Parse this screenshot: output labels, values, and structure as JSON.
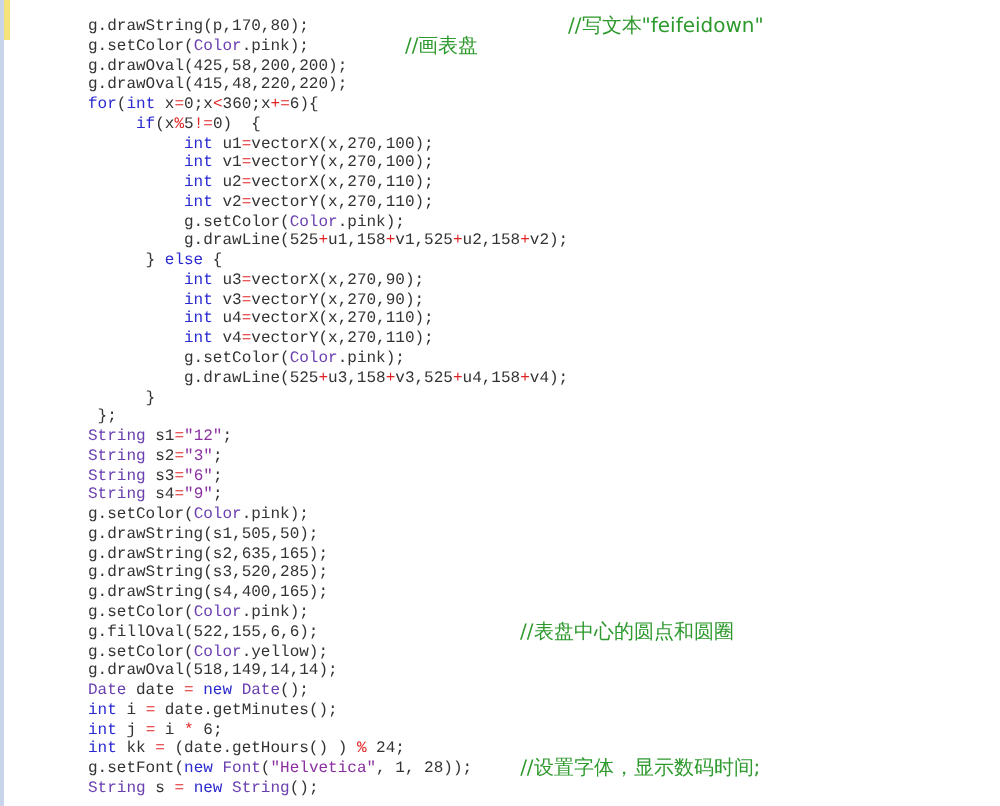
{
  "editor": {
    "lines": [
      {
        "code": [
          {
            "text": "g.drawString(p,170,80);                           ",
            "kind": "plain"
          }
        ],
        "comment": "//写文本\"feifeidown\""
      },
      {
        "code": [
          {
            "text": "g.setColor(",
            "kind": "plain"
          },
          {
            "text": "Color",
            "kind": "class"
          },
          {
            "text": ".pink);          ",
            "kind": "plain"
          }
        ],
        "comment": "//画表盘"
      },
      {
        "code": [
          {
            "text": "g.drawOval(425,58,200,200);",
            "kind": "plain"
          }
        ]
      },
      {
        "code": [
          {
            "text": "g.drawOval(415,48,220,220);",
            "kind": "plain"
          }
        ]
      },
      {
        "code": [
          {
            "text": "for",
            "kind": "keyword"
          },
          {
            "text": "(",
            "kind": "plain"
          },
          {
            "text": "int",
            "kind": "keyword"
          },
          {
            "text": " x",
            "kind": "plain"
          },
          {
            "text": "=",
            "kind": "operator"
          },
          {
            "text": "0;x",
            "kind": "plain"
          },
          {
            "text": "<",
            "kind": "operator"
          },
          {
            "text": "360;x",
            "kind": "plain"
          },
          {
            "text": "+=",
            "kind": "operator"
          },
          {
            "text": "6){",
            "kind": "plain"
          }
        ]
      },
      {
        "code": [
          {
            "text": "     if",
            "kind": "keyword"
          },
          {
            "text": "(x",
            "kind": "plain"
          },
          {
            "text": "%",
            "kind": "operator"
          },
          {
            "text": "5",
            "kind": "plain"
          },
          {
            "text": "!=",
            "kind": "operator"
          },
          {
            "text": "0)  {",
            "kind": "plain"
          }
        ]
      },
      {
        "code": [
          {
            "text": "          int",
            "kind": "keyword"
          },
          {
            "text": " u1",
            "kind": "plain"
          },
          {
            "text": "=",
            "kind": "operator"
          },
          {
            "text": "vectorX(x,270,100);",
            "kind": "plain"
          }
        ]
      },
      {
        "code": [
          {
            "text": "          int",
            "kind": "keyword"
          },
          {
            "text": " v1",
            "kind": "plain"
          },
          {
            "text": "=",
            "kind": "operator"
          },
          {
            "text": "vectorY(x,270,100);",
            "kind": "plain"
          }
        ]
      },
      {
        "code": [
          {
            "text": "          int",
            "kind": "keyword"
          },
          {
            "text": " u2",
            "kind": "plain"
          },
          {
            "text": "=",
            "kind": "operator"
          },
          {
            "text": "vectorX(x,270,110);",
            "kind": "plain"
          }
        ]
      },
      {
        "code": [
          {
            "text": "          int",
            "kind": "keyword"
          },
          {
            "text": " v2",
            "kind": "plain"
          },
          {
            "text": "=",
            "kind": "operator"
          },
          {
            "text": "vectorY(x,270,110);",
            "kind": "plain"
          }
        ]
      },
      {
        "code": [
          {
            "text": "          g.setColor(",
            "kind": "plain"
          },
          {
            "text": "Color",
            "kind": "class"
          },
          {
            "text": ".pink);",
            "kind": "plain"
          }
        ]
      },
      {
        "code": [
          {
            "text": "          g.drawLine(525",
            "kind": "plain"
          },
          {
            "text": "+",
            "kind": "operator"
          },
          {
            "text": "u1,158",
            "kind": "plain"
          },
          {
            "text": "+",
            "kind": "operator"
          },
          {
            "text": "v1,525",
            "kind": "plain"
          },
          {
            "text": "+",
            "kind": "operator"
          },
          {
            "text": "u2,158",
            "kind": "plain"
          },
          {
            "text": "+",
            "kind": "operator"
          },
          {
            "text": "v2);",
            "kind": "plain"
          }
        ]
      },
      {
        "code": [
          {
            "text": "      } ",
            "kind": "plain"
          },
          {
            "text": "else",
            "kind": "keyword"
          },
          {
            "text": " {",
            "kind": "plain"
          }
        ]
      },
      {
        "code": [
          {
            "text": "          int",
            "kind": "keyword"
          },
          {
            "text": " u3",
            "kind": "plain"
          },
          {
            "text": "=",
            "kind": "operator"
          },
          {
            "text": "vectorX(x,270,90);",
            "kind": "plain"
          }
        ]
      },
      {
        "code": [
          {
            "text": "          int",
            "kind": "keyword"
          },
          {
            "text": " v3",
            "kind": "plain"
          },
          {
            "text": "=",
            "kind": "operator"
          },
          {
            "text": "vectorY(x,270,90);",
            "kind": "plain"
          }
        ]
      },
      {
        "code": [
          {
            "text": "          int",
            "kind": "keyword"
          },
          {
            "text": " u4",
            "kind": "plain"
          },
          {
            "text": "=",
            "kind": "operator"
          },
          {
            "text": "vectorX(x,270,110);",
            "kind": "plain"
          }
        ]
      },
      {
        "code": [
          {
            "text": "          int",
            "kind": "keyword"
          },
          {
            "text": " v4",
            "kind": "plain"
          },
          {
            "text": "=",
            "kind": "operator"
          },
          {
            "text": "vectorY(x,270,110);",
            "kind": "plain"
          }
        ]
      },
      {
        "code": [
          {
            "text": "          g.setColor(",
            "kind": "plain"
          },
          {
            "text": "Color",
            "kind": "class"
          },
          {
            "text": ".pink);",
            "kind": "plain"
          }
        ]
      },
      {
        "code": [
          {
            "text": "          g.drawLine(525",
            "kind": "plain"
          },
          {
            "text": "+",
            "kind": "operator"
          },
          {
            "text": "u3,158",
            "kind": "plain"
          },
          {
            "text": "+",
            "kind": "operator"
          },
          {
            "text": "v3,525",
            "kind": "plain"
          },
          {
            "text": "+",
            "kind": "operator"
          },
          {
            "text": "u4,158",
            "kind": "plain"
          },
          {
            "text": "+",
            "kind": "operator"
          },
          {
            "text": "v4);",
            "kind": "plain"
          }
        ]
      },
      {
        "code": [
          {
            "text": "      }",
            "kind": "plain"
          }
        ]
      },
      {
        "code": [
          {
            "text": " };",
            "kind": "plain"
          }
        ]
      },
      {
        "code": [
          {
            "text": "String",
            "kind": "class"
          },
          {
            "text": " s1",
            "kind": "plain"
          },
          {
            "text": "=",
            "kind": "operator"
          },
          {
            "text": "\"12\"",
            "kind": "string"
          },
          {
            "text": ";",
            "kind": "plain"
          }
        ]
      },
      {
        "code": [
          {
            "text": "String",
            "kind": "class"
          },
          {
            "text": " s2",
            "kind": "plain"
          },
          {
            "text": "=",
            "kind": "operator"
          },
          {
            "text": "\"3\"",
            "kind": "string"
          },
          {
            "text": ";",
            "kind": "plain"
          }
        ]
      },
      {
        "code": [
          {
            "text": "String",
            "kind": "class"
          },
          {
            "text": " s3",
            "kind": "plain"
          },
          {
            "text": "=",
            "kind": "operator"
          },
          {
            "text": "\"6\"",
            "kind": "string"
          },
          {
            "text": ";",
            "kind": "plain"
          }
        ]
      },
      {
        "code": [
          {
            "text": "String",
            "kind": "class"
          },
          {
            "text": " s4",
            "kind": "plain"
          },
          {
            "text": "=",
            "kind": "operator"
          },
          {
            "text": "\"9\"",
            "kind": "string"
          },
          {
            "text": ";",
            "kind": "plain"
          }
        ]
      },
      {
        "code": [
          {
            "text": "g.setColor(",
            "kind": "plain"
          },
          {
            "text": "Color",
            "kind": "class"
          },
          {
            "text": ".pink);",
            "kind": "plain"
          }
        ]
      },
      {
        "code": [
          {
            "text": "g.drawString(s1,505,50);",
            "kind": "plain"
          }
        ]
      },
      {
        "code": [
          {
            "text": "g.drawString(s2,635,165);",
            "kind": "plain"
          }
        ]
      },
      {
        "code": [
          {
            "text": "g.drawString(s3,520,285);",
            "kind": "plain"
          }
        ]
      },
      {
        "code": [
          {
            "text": "g.drawString(s4,400,165);",
            "kind": "plain"
          }
        ]
      },
      {
        "code": [
          {
            "text": "g.setColor(",
            "kind": "plain"
          },
          {
            "text": "Color",
            "kind": "class"
          },
          {
            "text": ".pink);",
            "kind": "plain"
          }
        ]
      },
      {
        "code": [
          {
            "text": "g.fillOval(522,155,6,6);                     ",
            "kind": "plain"
          }
        ],
        "comment": "//表盘中心的圆点和圆圈"
      },
      {
        "code": [
          {
            "text": "g.setColor(",
            "kind": "plain"
          },
          {
            "text": "Color",
            "kind": "class"
          },
          {
            "text": ".yellow);",
            "kind": "plain"
          }
        ]
      },
      {
        "code": [
          {
            "text": "g.drawOval(518,149,14,14);",
            "kind": "plain"
          }
        ]
      },
      {
        "code": [
          {
            "text": "Date",
            "kind": "class"
          },
          {
            "text": " date ",
            "kind": "plain"
          },
          {
            "text": "= ",
            "kind": "operator"
          },
          {
            "text": "new ",
            "kind": "keyword"
          },
          {
            "text": "Date",
            "kind": "class"
          },
          {
            "text": "();",
            "kind": "plain"
          }
        ]
      },
      {
        "code": [
          {
            "text": "int",
            "kind": "keyword"
          },
          {
            "text": " i ",
            "kind": "plain"
          },
          {
            "text": "=",
            "kind": "operator"
          },
          {
            "text": " date.getMinutes();",
            "kind": "plain"
          }
        ]
      },
      {
        "code": [
          {
            "text": "int",
            "kind": "keyword"
          },
          {
            "text": " j ",
            "kind": "plain"
          },
          {
            "text": "=",
            "kind": "operator"
          },
          {
            "text": " i ",
            "kind": "plain"
          },
          {
            "text": "*",
            "kind": "operator"
          },
          {
            "text": " 6;",
            "kind": "plain"
          }
        ]
      },
      {
        "code": [
          {
            "text": "int",
            "kind": "keyword"
          },
          {
            "text": " kk ",
            "kind": "plain"
          },
          {
            "text": "=",
            "kind": "operator"
          },
          {
            "text": " (date.getHours() ) ",
            "kind": "plain"
          },
          {
            "text": "%",
            "kind": "operator"
          },
          {
            "text": " 24;",
            "kind": "plain"
          }
        ]
      },
      {
        "code": [
          {
            "text": "g.setFont(",
            "kind": "plain"
          },
          {
            "text": "new ",
            "kind": "keyword"
          },
          {
            "text": "Font",
            "kind": "class"
          },
          {
            "text": "(",
            "kind": "plain"
          },
          {
            "text": "\"Helvetica\"",
            "kind": "string"
          },
          {
            "text": ", 1, 28));     ",
            "kind": "plain"
          }
        ],
        "comment": "//设置字体，显示数码时间;"
      },
      {
        "code": [
          {
            "text": "String",
            "kind": "class"
          },
          {
            "text": " s ",
            "kind": "plain"
          },
          {
            "text": "= ",
            "kind": "operator"
          },
          {
            "text": "new ",
            "kind": "keyword"
          },
          {
            "text": "String",
            "kind": "class"
          },
          {
            "text": "();",
            "kind": "plain"
          }
        ]
      }
    ]
  }
}
